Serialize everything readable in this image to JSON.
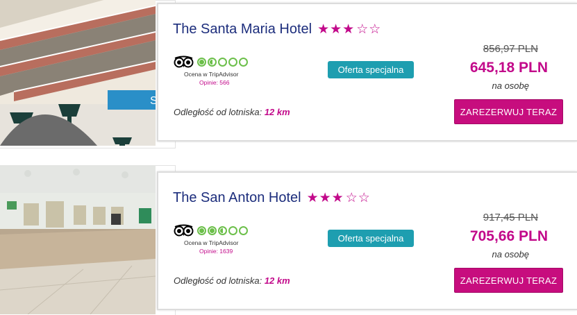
{
  "hotels": [
    {
      "name": "The Santa Maria Hotel",
      "stars": {
        "filled": "★★★",
        "empty": "☆☆"
      },
      "tripadvisor": {
        "caption": "Ocena w TripAdvisor",
        "reviews": "Opinie: 566",
        "rating": 1.5
      },
      "offer": "Oferta specjalna",
      "distance_label": "Odległość od lotniska:",
      "distance_value": "12 km",
      "old_price": "856,97 PLN",
      "new_price": "645,18 PLN",
      "per_person": "na osobę",
      "book_label": "ZAREZERWUJ TERAZ"
    },
    {
      "name": "The San Anton Hotel",
      "stars": {
        "filled": "★★★",
        "empty": "☆☆"
      },
      "tripadvisor": {
        "caption": "Ocena w TripAdvisor",
        "reviews": "Opinie: 1639",
        "rating": 2.5
      },
      "offer": "Oferta specjalna",
      "distance_label": "Odległość od lotniska:",
      "distance_value": "12 km",
      "old_price": "917,45 PLN",
      "new_price": "705,66 PLN",
      "per_person": "na osobę",
      "book_label": "ZAREZERWUJ TERAZ"
    }
  ],
  "colors": {
    "accent": "#c2098a",
    "title": "#1c2d7c",
    "badge": "#1e9eb0",
    "bubble": "#6cbf4a"
  }
}
